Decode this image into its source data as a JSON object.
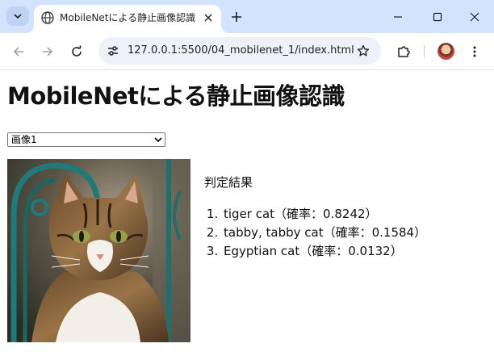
{
  "browser": {
    "tab_title": "MobileNetによる静止画像認識",
    "url": "127.0.0.1:5500/04_mobilenet_1/index.html"
  },
  "icons": {
    "tab_search": "chevron-down-icon",
    "favicon": "globe-icon",
    "tab_close": "close-icon",
    "new_tab": "plus-icon",
    "minimize": "minimize-icon",
    "maximize": "maximize-icon",
    "close_window": "close-icon",
    "back": "arrow-left-icon",
    "forward": "arrow-right-icon",
    "reload": "reload-icon",
    "site_info": "site-info-icon",
    "bookmark": "star-icon",
    "extensions": "puzzle-icon",
    "menu": "more-vertical-icon"
  },
  "page": {
    "heading": "MobileNetによる静止画像認識",
    "image_select": {
      "selected": "画像1"
    },
    "image_alt": "tabby cat photo",
    "result_title": "判定結果",
    "results": [
      "tiger cat（確率：0.8242）",
      "tabby, tabby cat（確率：0.1584）",
      "Egyptian cat（確率：0.0132）"
    ]
  },
  "colors": {
    "tabstrip": "#d3e3fd",
    "omnibox": "#edf2fa",
    "text": "#111111"
  }
}
